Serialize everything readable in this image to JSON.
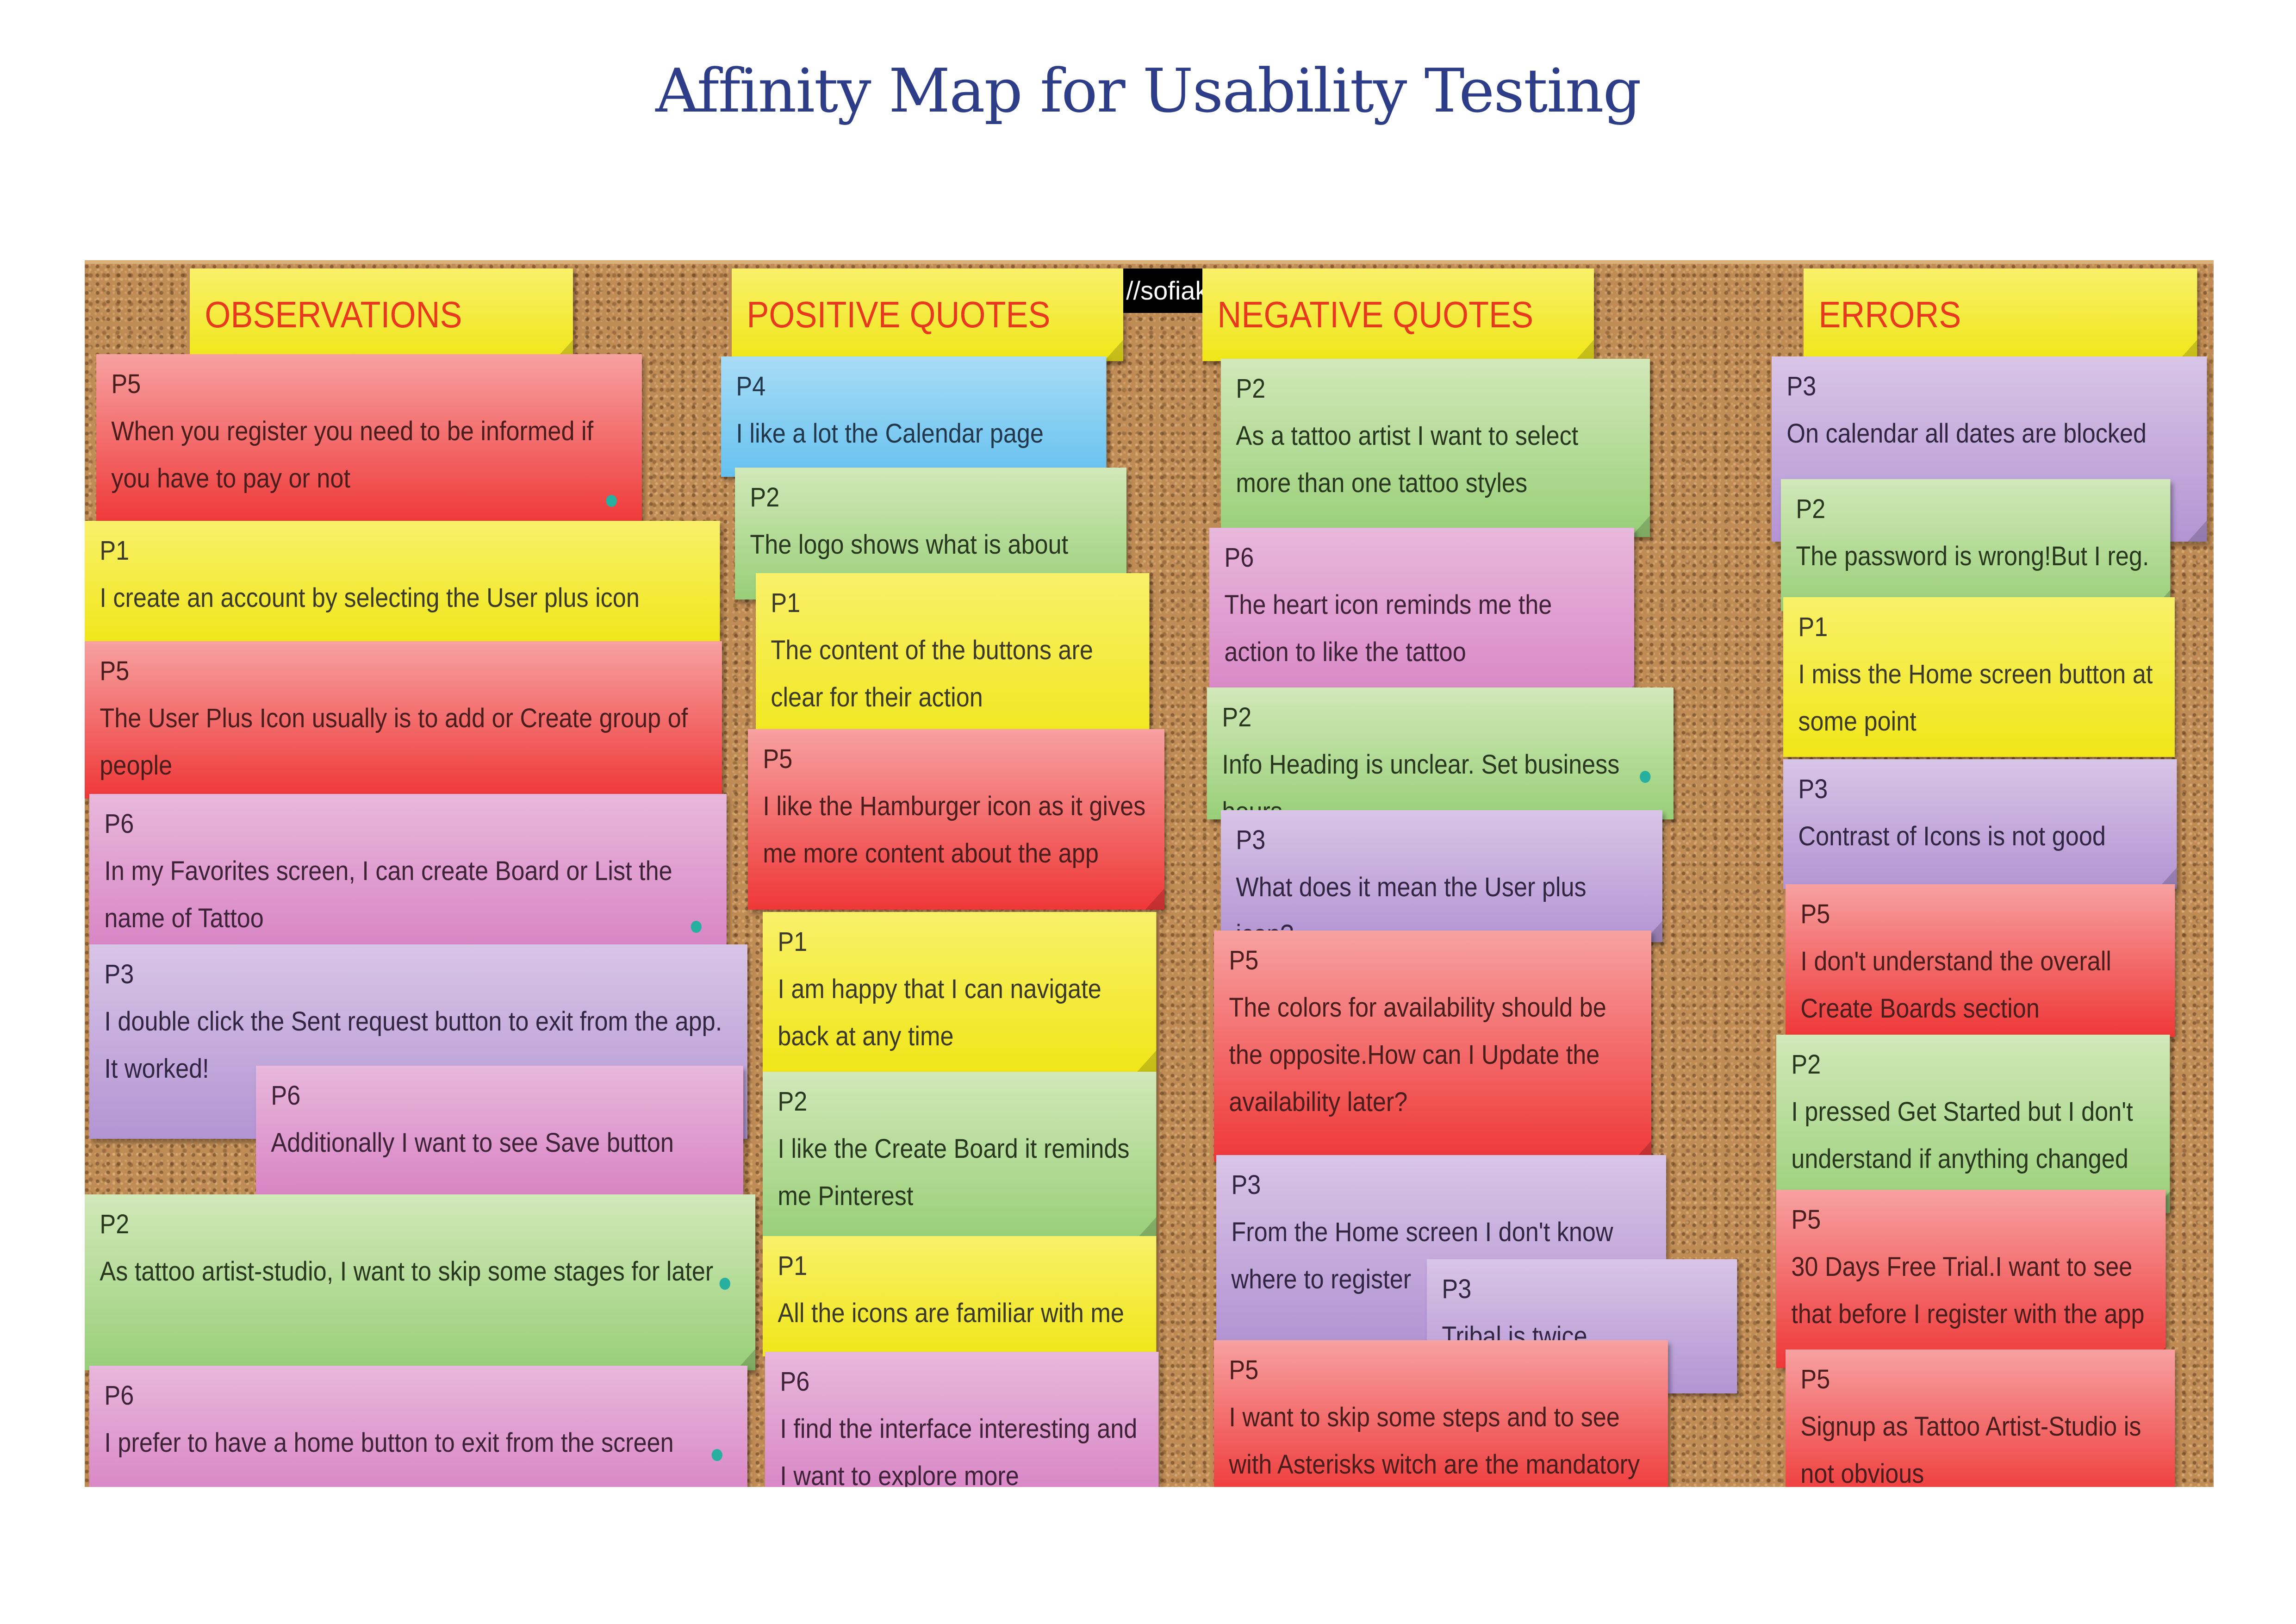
{
  "title": "Affinity Map for Usability Testing",
  "url_fragment": "//sofiak",
  "headers": {
    "observations": "OBSERVATIONS",
    "positive": "POSITIVE QUOTES",
    "negative": "NEGATIVE QUOTES",
    "errors": "ERRORS"
  },
  "observations": [
    {
      "p": "P5",
      "text": "When you register you need to be informed if you have to pay or not",
      "color": "red"
    },
    {
      "p": "P1",
      "text": "I create an account by selecting the User plus icon",
      "color": "yellow"
    },
    {
      "p": "P5",
      "text": "The User Plus Icon usually is to add or Create group of people",
      "color": "red"
    },
    {
      "p": "P6",
      "text": "In my Favorites screen, I can create Board or List the name of Tattoo",
      "color": "pink"
    },
    {
      "p": "P3",
      "text": "I double click the Sent request button to exit from the app.",
      "text2": "It worked!",
      "color": "purple"
    },
    {
      "p": "P6",
      "text": "Additionally I want to see Save button",
      "color": "pink"
    },
    {
      "p": "P2",
      "text": "As tattoo artist-studio, I want to skip some stages for later",
      "color": "green"
    },
    {
      "p": "P6",
      "text": "I prefer to have a home button to exit from the screen",
      "color": "pink"
    }
  ],
  "positive": [
    {
      "p": "P4",
      "text": "I like a lot the Calendar page",
      "color": "blue"
    },
    {
      "p": "P2",
      "text": "The logo shows what is about",
      "color": "green"
    },
    {
      "p": "P1",
      "text": "The content of the buttons are clear for their action",
      "color": "yellow"
    },
    {
      "p": "P5",
      "text": "I like the Hamburger icon as it gives me more content about the app",
      "color": "red"
    },
    {
      "p": "P1",
      "text": "I am happy that I can navigate back at any time",
      "color": "yellow"
    },
    {
      "p": "P2",
      "text": "I like the Create Board it reminds me Pinterest",
      "color": "green"
    },
    {
      "p": "P1",
      "text": "All the icons are familiar with me",
      "color": "yellow"
    },
    {
      "p": "P6",
      "text": "I find the interface interesting and I want to explore more",
      "color": "pink"
    }
  ],
  "negative": [
    {
      "p": "P2",
      "text": "As a tattoo artist I want to select more than one tattoo styles",
      "color": "green"
    },
    {
      "p": "P6",
      "text": "The heart icon reminds me the action to like the tattoo",
      "color": "pink"
    },
    {
      "p": "P2",
      "text": "Info Heading is unclear. Set business hours",
      "color": "green"
    },
    {
      "p": "P3",
      "text": "What does it mean the User plus icon?",
      "color": "purple"
    },
    {
      "p": "P5",
      "text": "The colors for availability should be the opposite.How can I Update the availability later?",
      "color": "red"
    },
    {
      "p": "P3",
      "text": "From the Home screen I don't know where to register",
      "color": "purple"
    },
    {
      "p": "P3",
      "text": "Tribal is twice",
      "color": "purple"
    },
    {
      "p": "P5",
      "text": "I want to skip some steps and to see with Asterisks witch are the mandatory fields",
      "color": "red"
    }
  ],
  "errors": [
    {
      "p": "P3",
      "text": "On calendar all dates are blocked",
      "color": "purple"
    },
    {
      "p": "P2",
      "text": "The password is wrong!But I reg.",
      "color": "green"
    },
    {
      "p": "P1",
      "text": "I miss the Home screen button at some point",
      "color": "yellow"
    },
    {
      "p": "P3",
      "text": "Contrast of Icons is not good",
      "color": "purple"
    },
    {
      "p": "P5",
      "text": "I don't understand the overall Create Boards section",
      "color": "red"
    },
    {
      "p": "P2",
      "text": "I pressed Get Started but I don't understand if anything changed",
      "color": "green"
    },
    {
      "p": "P5",
      "text": "30 Days Free Trial.I want to see that before I register with the app",
      "color": "red"
    },
    {
      "p": "P5",
      "text": "Signup as Tattoo Artist-Studio is not obvious",
      "color": "red"
    }
  ],
  "colors": {
    "title": "#2e3d87",
    "header_text": "#e8391f",
    "dot": "#27b0a0"
  }
}
